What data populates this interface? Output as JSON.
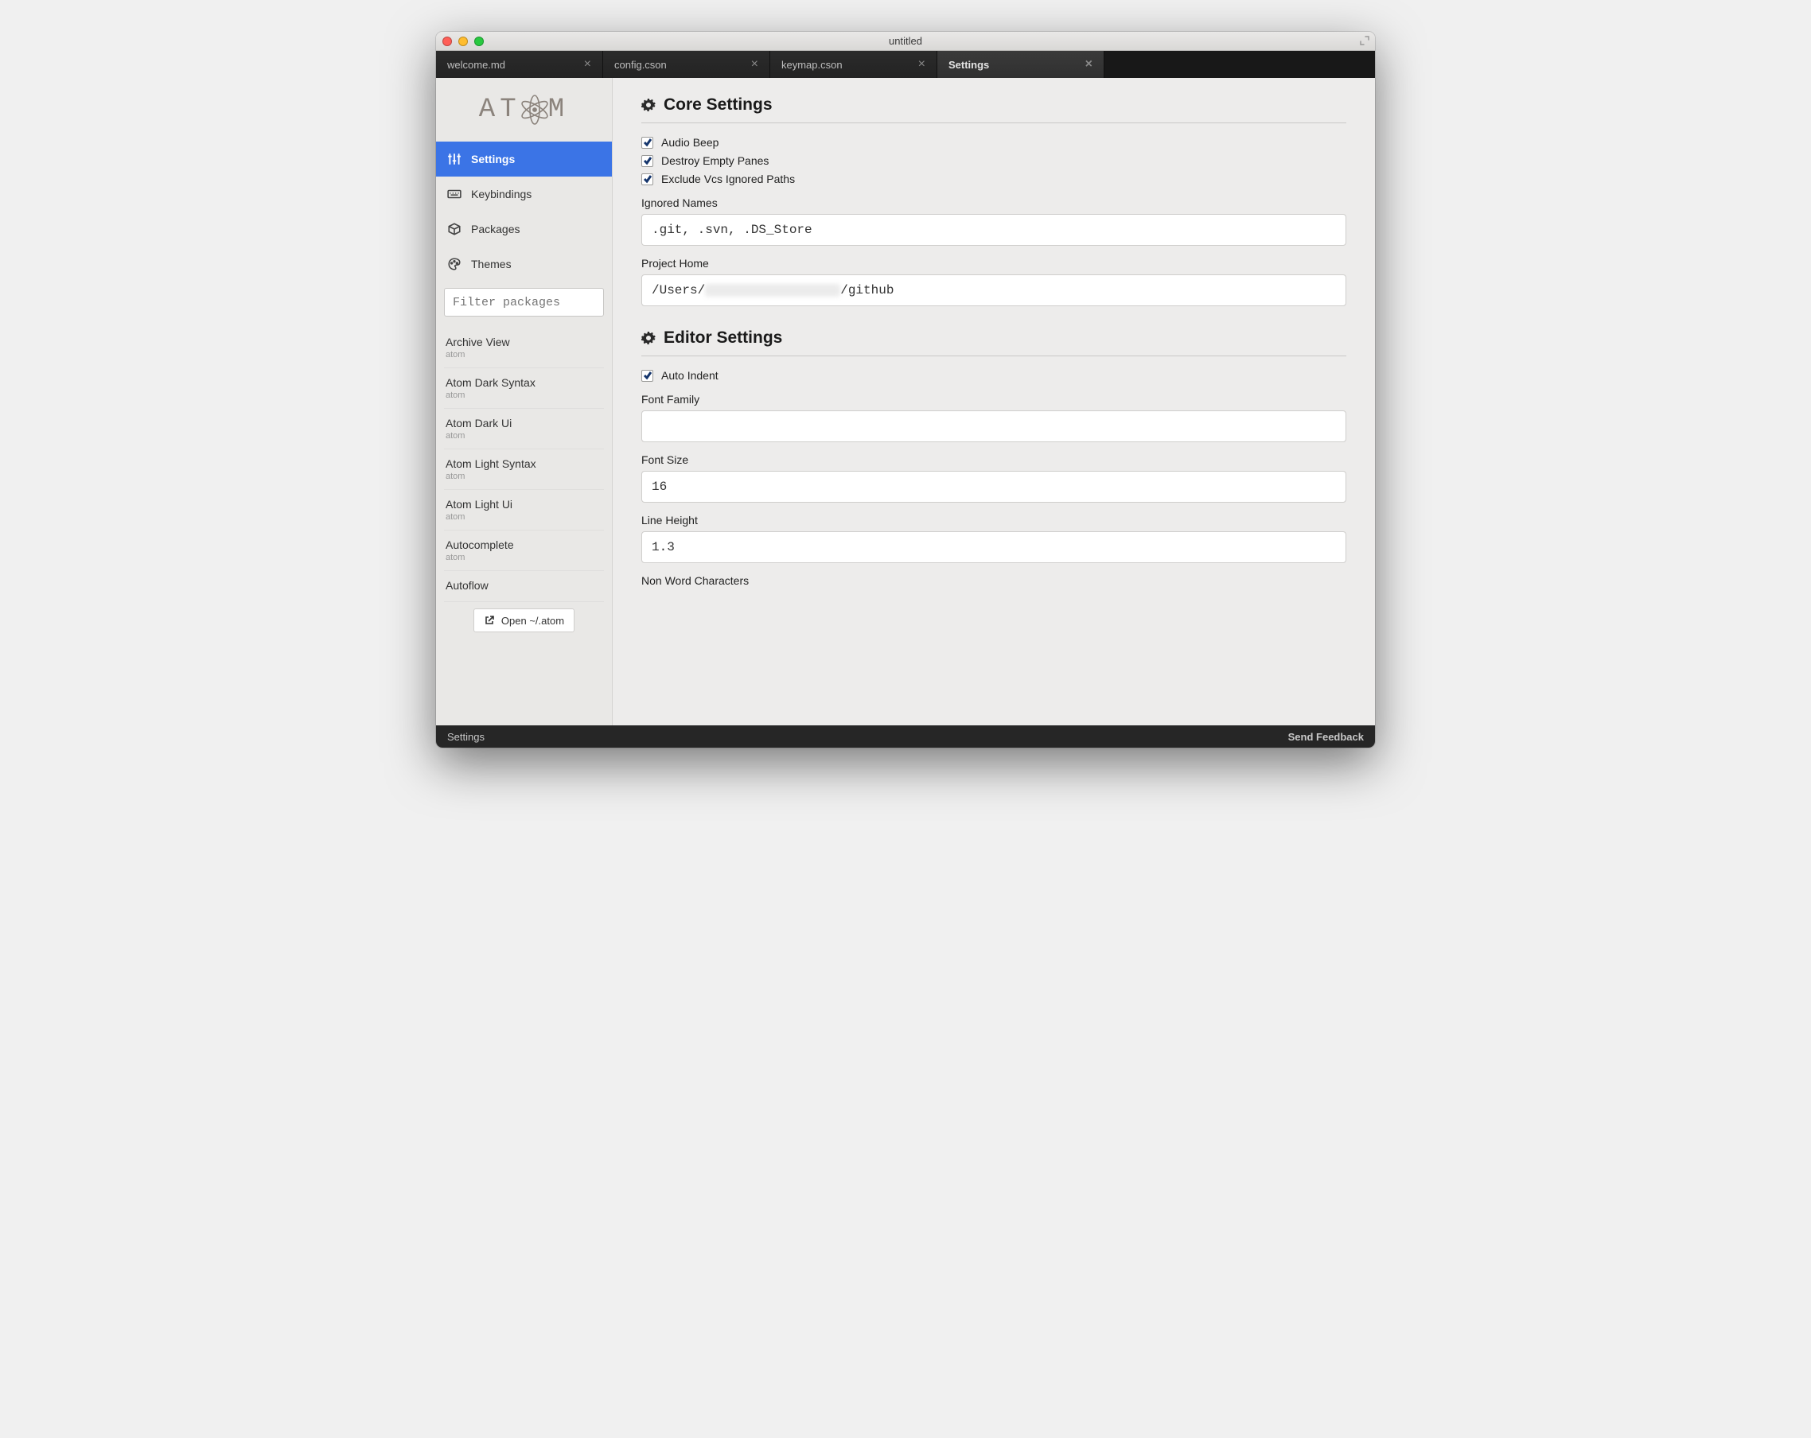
{
  "window": {
    "title": "untitled"
  },
  "tabs": [
    {
      "label": "welcome.md",
      "active": false
    },
    {
      "label": "config.cson",
      "active": false
    },
    {
      "label": "keymap.cson",
      "active": false
    },
    {
      "label": "Settings",
      "active": true
    }
  ],
  "sidebar": {
    "logo_text_a": "AT",
    "logo_text_b": "M",
    "nav": [
      {
        "icon": "sliders-icon",
        "label": "Settings",
        "active": true
      },
      {
        "icon": "keyboard-icon",
        "label": "Keybindings",
        "active": false
      },
      {
        "icon": "package-icon",
        "label": "Packages",
        "active": false
      },
      {
        "icon": "palette-icon",
        "label": "Themes",
        "active": false
      }
    ],
    "filter_placeholder": "Filter packages",
    "packages": [
      {
        "name": "Archive View",
        "author": "atom"
      },
      {
        "name": "Atom Dark Syntax",
        "author": "atom"
      },
      {
        "name": "Atom Dark Ui",
        "author": "atom"
      },
      {
        "name": "Atom Light Syntax",
        "author": "atom"
      },
      {
        "name": "Atom Light Ui",
        "author": "atom"
      },
      {
        "name": "Autocomplete",
        "author": "atom"
      },
      {
        "name": "Autoflow",
        "author": ""
      }
    ],
    "open_button": "Open ~/.atom"
  },
  "core": {
    "heading": "Core Settings",
    "audio_beep": {
      "label": "Audio Beep",
      "checked": true
    },
    "destroy_empty": {
      "label": "Destroy Empty Panes",
      "checked": true
    },
    "exclude_vcs": {
      "label": "Exclude Vcs Ignored Paths",
      "checked": true
    },
    "ignored_names": {
      "label": "Ignored Names",
      "value": ".git, .svn, .DS_Store"
    },
    "project_home": {
      "label": "Project Home",
      "prefix": "/Users/",
      "suffix": "/github"
    }
  },
  "editor": {
    "heading": "Editor Settings",
    "auto_indent": {
      "label": "Auto Indent",
      "checked": true
    },
    "font_family": {
      "label": "Font Family",
      "value": ""
    },
    "font_size": {
      "label": "Font Size",
      "value": "16"
    },
    "line_height": {
      "label": "Line Height",
      "value": "1.3"
    },
    "non_word": {
      "label": "Non Word Characters"
    }
  },
  "status": {
    "left": "Settings",
    "right": "Send Feedback"
  }
}
